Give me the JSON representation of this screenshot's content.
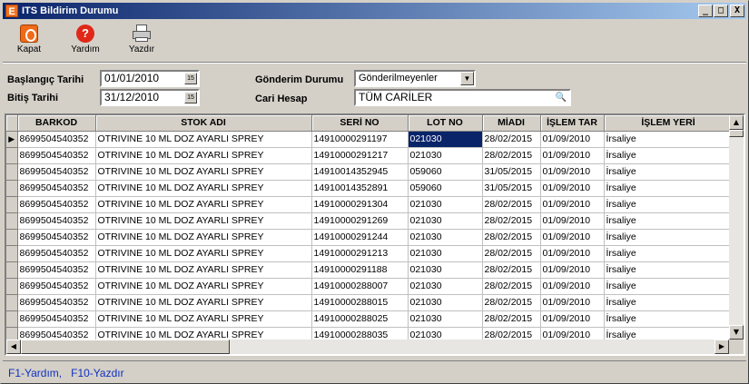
{
  "window": {
    "title": "ITS Bildirim Durumu",
    "icon_letter": "E",
    "controls": {
      "minimize": "_",
      "maximize": "□",
      "close": "X"
    }
  },
  "toolbar": {
    "kapat": "Kapat",
    "yardim": "Yardım",
    "yazdir": "Yazdır",
    "yardim_icon_glyph": "?"
  },
  "filters": {
    "baslangic_label": "Başlangıç Tarihi",
    "baslangic_value": "01/01/2010",
    "bitis_label": "Bitiş Tarihi",
    "bitis_value": "31/12/2010",
    "gonderim_label": "Gönderim Durumu",
    "gonderim_value": "Gönderilmeyenler",
    "cari_label": "Cari Hesap",
    "cari_value": "TÜM CARİLER",
    "calendar_glyph": "15"
  },
  "grid": {
    "columns": [
      "BARKOD",
      "STOK ADI",
      "SERİ NO",
      "LOT NO",
      "MİADI",
      "İŞLEM TAR",
      "İŞLEM YERİ"
    ],
    "selected_row": 0,
    "selected_col": 3,
    "rows": [
      [
        "8699504540352",
        "OTRIVINE 10 ML DOZ AYARLI SPREY",
        "14910000291197",
        "021030",
        "28/02/2015",
        "01/09/2010",
        "İrsaliye"
      ],
      [
        "8699504540352",
        "OTRIVINE 10 ML DOZ AYARLI SPREY",
        "14910000291217",
        "021030",
        "28/02/2015",
        "01/09/2010",
        "İrsaliye"
      ],
      [
        "8699504540352",
        "OTRIVINE 10 ML DOZ AYARLI SPREY",
        "14910014352945",
        "059060",
        "31/05/2015",
        "01/09/2010",
        "İrsaliye"
      ],
      [
        "8699504540352",
        "OTRIVINE 10 ML DOZ AYARLI SPREY",
        "14910014352891",
        "059060",
        "31/05/2015",
        "01/09/2010",
        "İrsaliye"
      ],
      [
        "8699504540352",
        "OTRIVINE 10 ML DOZ AYARLI SPREY",
        "14910000291304",
        "021030",
        "28/02/2015",
        "01/09/2010",
        "İrsaliye"
      ],
      [
        "8699504540352",
        "OTRIVINE 10 ML DOZ AYARLI SPREY",
        "14910000291269",
        "021030",
        "28/02/2015",
        "01/09/2010",
        "İrsaliye"
      ],
      [
        "8699504540352",
        "OTRIVINE 10 ML DOZ AYARLI SPREY",
        "14910000291244",
        "021030",
        "28/02/2015",
        "01/09/2010",
        "İrsaliye"
      ],
      [
        "8699504540352",
        "OTRIVINE 10 ML DOZ AYARLI SPREY",
        "14910000291213",
        "021030",
        "28/02/2015",
        "01/09/2010",
        "İrsaliye"
      ],
      [
        "8699504540352",
        "OTRIVINE 10 ML DOZ AYARLI SPREY",
        "14910000291188",
        "021030",
        "28/02/2015",
        "01/09/2010",
        "İrsaliye"
      ],
      [
        "8699504540352",
        "OTRIVINE 10 ML DOZ AYARLI SPREY",
        "14910000288007",
        "021030",
        "28/02/2015",
        "01/09/2010",
        "İrsaliye"
      ],
      [
        "8699504540352",
        "OTRIVINE 10 ML DOZ AYARLI SPREY",
        "14910000288015",
        "021030",
        "28/02/2015",
        "01/09/2010",
        "İrsaliye"
      ],
      [
        "8699504540352",
        "OTRIVINE 10 ML DOZ AYARLI SPREY",
        "14910000288025",
        "021030",
        "28/02/2015",
        "01/09/2010",
        "İrsaliye"
      ],
      [
        "8699504540352",
        "OTRIVINE 10 ML DOZ AYARLI SPREY",
        "14910000288035",
        "021030",
        "28/02/2015",
        "01/09/2010",
        "İrsaliye"
      ]
    ]
  },
  "statusbar": {
    "text": "F1-Yardım,   F10-Yazdır"
  },
  "colors": {
    "title_start": "#0a246a",
    "title_end": "#a6caf0",
    "selection": "#0a246a",
    "status_text": "#1030c0",
    "kapat_icon": "#f06a18",
    "yardim_icon": "#e02818"
  },
  "icons": [
    "app-icon",
    "kapat-icon",
    "yardim-icon",
    "yazdir-icon",
    "calendar-icon",
    "dropdown-arrow-icon",
    "search-icon"
  ]
}
